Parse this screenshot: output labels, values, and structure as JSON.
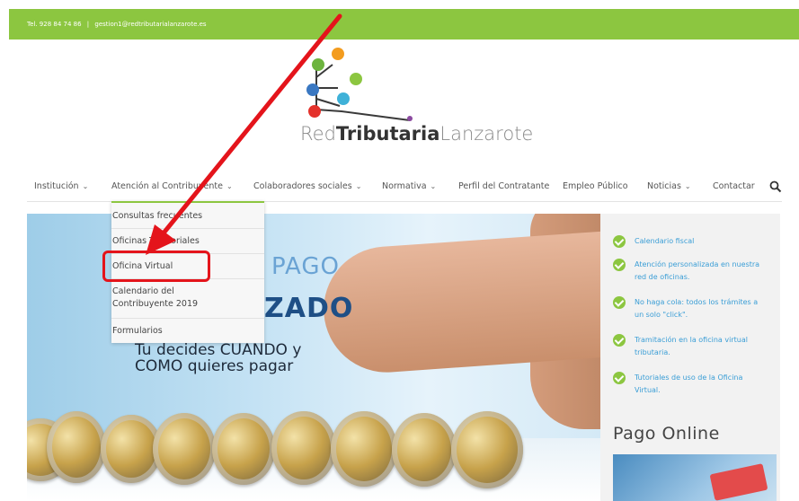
{
  "topbar": {
    "phone": "Tel. 928 84 74 86",
    "separator": "|",
    "email": "gestion1@redtributarialanzarote.es"
  },
  "logo": {
    "part1": "Red",
    "part2": "Tributaria",
    "part3": "Lanzarote"
  },
  "nav": {
    "items": [
      {
        "label": "Institución",
        "has_dropdown": true
      },
      {
        "label": "Atención al Contribuyente",
        "has_dropdown": true
      },
      {
        "label": "Colaboradores sociales",
        "has_dropdown": true
      },
      {
        "label": "Normativa",
        "has_dropdown": true
      },
      {
        "label": "Perfil del Contratante",
        "has_dropdown": false
      },
      {
        "label": "Empleo Público",
        "has_dropdown": false
      },
      {
        "label": "Noticias",
        "has_dropdown": true
      },
      {
        "label": "Contactar",
        "has_dropdown": false
      }
    ],
    "search_icon": "search-icon"
  },
  "dropdown": {
    "items": [
      {
        "label": "Consultas frecuentes"
      },
      {
        "label": "Oficinas Territoriales"
      },
      {
        "label": "Oficina Virtual",
        "highlighted": true
      },
      {
        "label_line1": "Calendario del",
        "label_line2": "Contribuyente 2019"
      },
      {
        "label": "Formularios"
      }
    ]
  },
  "hero": {
    "text_pago": "PAGO",
    "text_zado": "ZADO",
    "line1": "Tu decides CUANDO y",
    "line2": "COMO  quieres pagar"
  },
  "sidebar": {
    "items": [
      {
        "line1": "Calendario fiscal",
        "line2": ""
      },
      {
        "line1": "Atención personalizada en nuestra",
        "line2": "red de oficinas."
      },
      {
        "line1": "No haga cola: todos los trámites a",
        "line2": "un solo \"click\"."
      },
      {
        "line1": "Tramitación en la oficina virtual",
        "line2": "tributaria."
      },
      {
        "line1": "Tutoriales de uso de la Oficina",
        "line2": "Virtual."
      }
    ],
    "pago_title": "Pago Online"
  },
  "colors": {
    "accent_green": "#8cc640",
    "link_blue": "#3b9ed6",
    "annotation_red": "#e4141b"
  }
}
